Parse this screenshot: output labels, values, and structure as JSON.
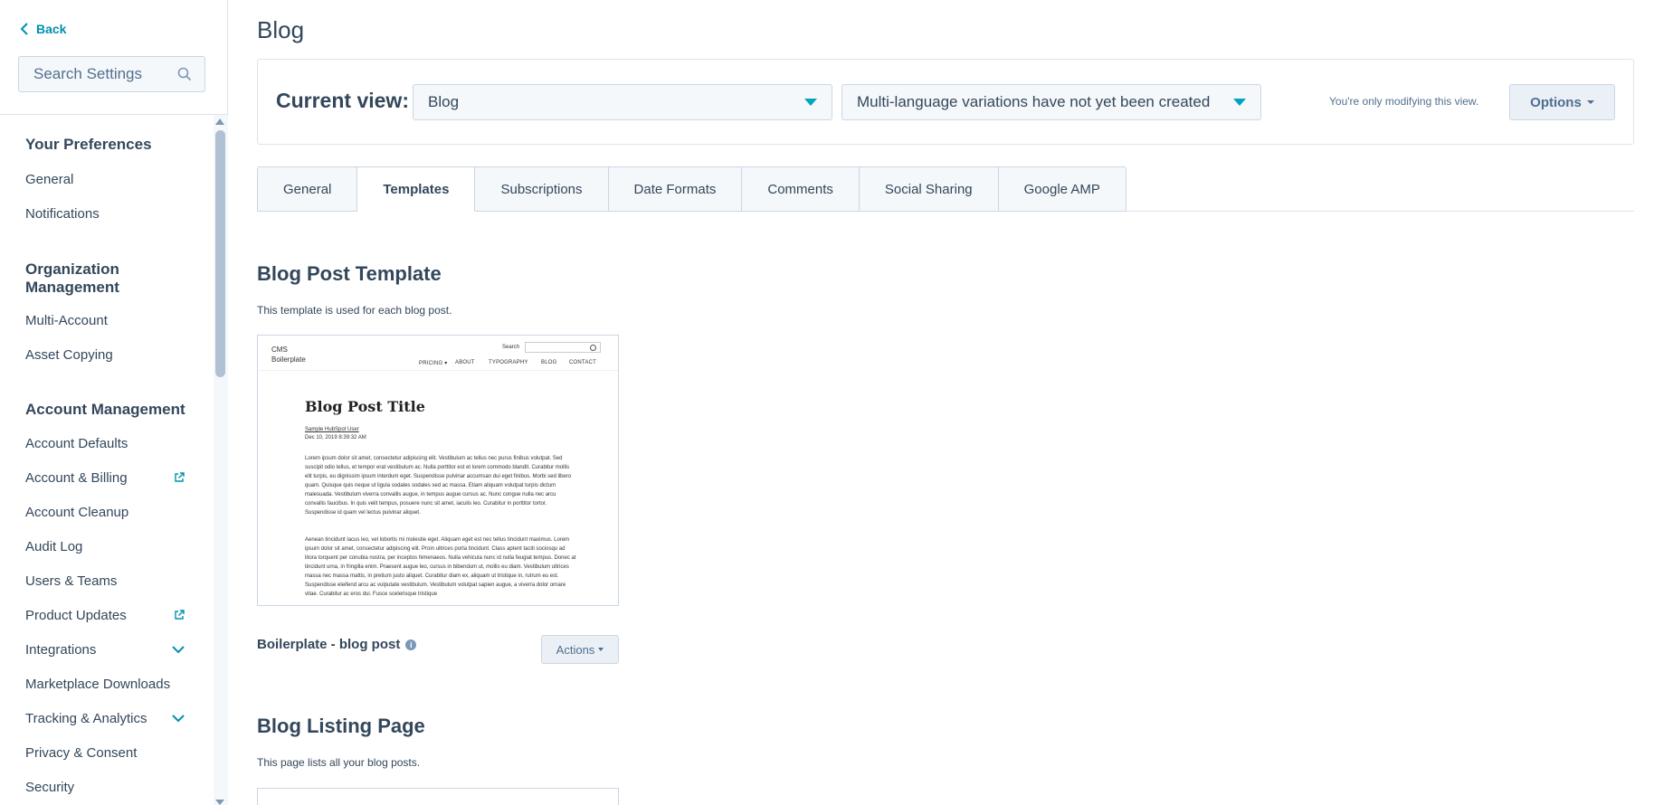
{
  "sidebar": {
    "back_label": "Back",
    "search_placeholder": "Search Settings",
    "groups": [
      {
        "title": "Your Preferences",
        "items": [
          "General",
          "Notifications"
        ]
      },
      {
        "title": "Organization Management",
        "items": [
          "Multi-Account",
          "Asset Copying"
        ]
      },
      {
        "title": "Account Management",
        "items": [
          "Account Defaults",
          "Account & Billing",
          "Account Cleanup",
          "Audit Log",
          "Users & Teams",
          "Product Updates",
          "Integrations",
          "Marketplace Downloads",
          "Tracking & Analytics",
          "Privacy & Consent",
          "Security"
        ]
      }
    ]
  },
  "page": {
    "title": "Blog",
    "current_view_label": "Current view:",
    "view_select": "Blog",
    "language_select": "Multi-language variations have not yet been created",
    "modifying_note": "You're only modifying this view.",
    "options_label": "Options"
  },
  "tabs": [
    "General",
    "Templates",
    "Subscriptions",
    "Date Formats",
    "Comments",
    "Social Sharing",
    "Google AMP"
  ],
  "active_tab": "Templates",
  "blog_post_template": {
    "title": "Blog Post Template",
    "description": "This template is used for each blog post.",
    "template_name": "Boilerplate - blog post",
    "actions_label": "Actions",
    "preview": {
      "logo_line1": "CMS",
      "logo_line2": "Boilerplate",
      "search_label": "Search",
      "nav": [
        "PRICING ▾",
        "ABOUT",
        "TYPOGRAPHY",
        "BLOG",
        "CONTACT"
      ],
      "post_title": "Blog Post Title",
      "author": "Sample HubSpot User",
      "date": "Dec 10, 2019 8:39:32 AM",
      "para1": "Lorem ipsum dolor sit amet, consectetur adipiscing elit. Vestibulum ac tellus nec purus finibus volutpat. Sed suscipit odio tellus, et tempor erat vestibulum ac. Nulla porttitor est et lorem commodo blandit. Curabitur mollis elit turpis, eu dignissim ipsum interdum eget. Suspendisse pulvinar accumsan dui eget finibus. Morbi sed libero quam. Quisque quis neque ut ligula sodales sodales sed ac massa. Etiam aliquam volutpat turpis dictum malesuada. Vestibulum viverra convallis augue, in tempus augue cursus ac. Nunc congue nulla nec arcu convallis faucibus. In quis velit tempus, posuere nunc sit amet, iaculis leo. Curabitur in porttitor tortor. Suspendisse id quam vel lectus pulvinar aliquet.",
      "para2": "Aenean tincidunt lacus leo, vel lobortis mi molestie eget. Aliquam eget est nec tellus tincidunt maximus. Lorem ipsum dolor sit amet, consectetur adipiscing elit. Proin ultrices porta tincidunt. Class aptent taciti sociosqu ad litora torquent per conubia nostra, per inceptos himenaeos. Nulla vehicula nunc id nulla feugiat tempus. Donec at tincidunt urna, in fringilla enim. Praesent augue leo, cursus in bibendum ut, mollis eu diam. Vestibulum ultrices massa nec massa mattis, in pretium justo aliquet. Curabitur diam ex, aliquam ut tristique in, rutrum eu est. Suspendisse eleifend arcu ac vulputate vestibulum. Vestibulum volutpat sapien augue, a viverra dolor ornare vitae. Curabitur ac eros dui. Fusce scelerisque tristique"
    }
  },
  "blog_listing": {
    "title": "Blog Listing Page",
    "description": "This page lists all your blog posts."
  }
}
